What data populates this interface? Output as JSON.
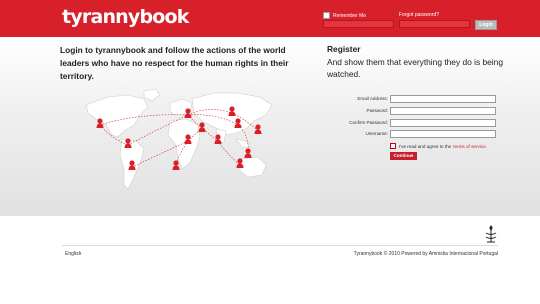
{
  "header": {
    "logo": "tyrannybook",
    "remember_label": "Remember Me",
    "forgot_label": "Forgot password?",
    "login_label": "Login"
  },
  "intro": {
    "text": "Login to tyrannybook and follow the actions of the world leaders who have no respect for the human rights in their territory."
  },
  "register": {
    "title": "Register",
    "subtitle": "And show them that everything they do is being watched.",
    "fields": {
      "email": "Email Address:",
      "password": "Password:",
      "confirm": "Confirm Password:",
      "username": "Username:"
    },
    "terms_text": "I've read and agree to the",
    "terms_link": "terms of service.",
    "continue_label": "Continue"
  },
  "footer": {
    "language": "English",
    "copyright": "Tyrannybook © 2010 Powered by Amnistia Internacional Portugal"
  },
  "colors": {
    "brand_red": "#d8202b"
  },
  "icons": {
    "map": "world-map-icon",
    "leader": "person-marker-icon",
    "amnesty": "candle-logo-icon"
  }
}
